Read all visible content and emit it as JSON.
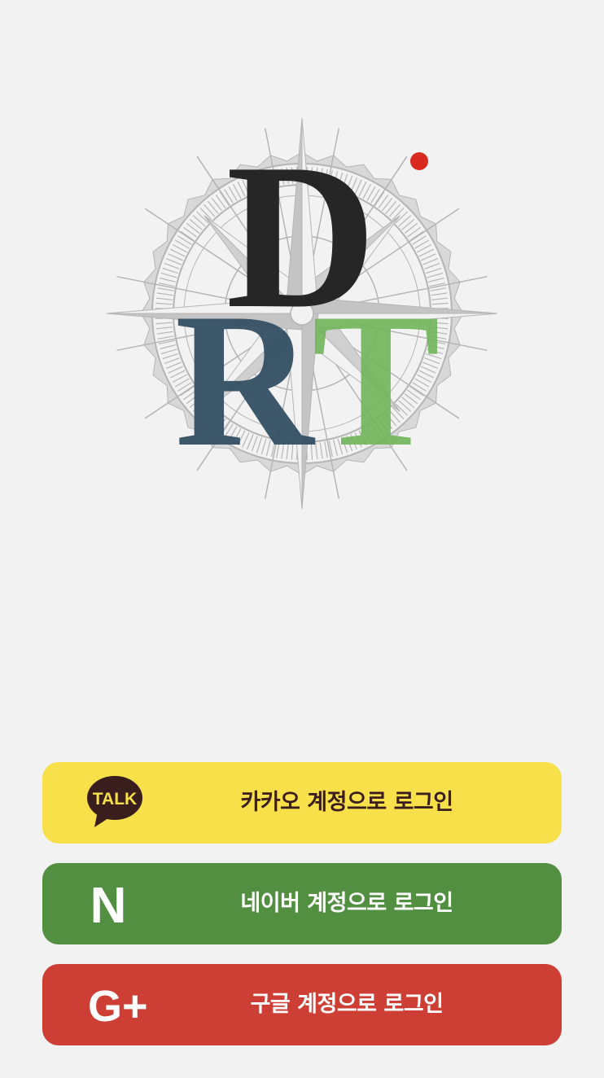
{
  "logo": {
    "letters": [
      "D",
      "R",
      "T"
    ],
    "colors": {
      "d": "#262626",
      "r": "#355064",
      "t": "#72b65a",
      "dot": "#d92a1f",
      "compass": "#b5b5b5"
    }
  },
  "login": {
    "kakao": {
      "label": "카카오 계정으로 로그인",
      "icon": "kakao-talk-icon",
      "icon_text": "TALK",
      "bg": "#f8e04b",
      "text_color": "#3a1d1d"
    },
    "naver": {
      "label": "네이버 계정으로 로그인",
      "icon": "naver-n-icon",
      "icon_text": "N",
      "bg": "#528f40",
      "text_color": "#ffffff"
    },
    "google": {
      "label": "구글 계정으로 로그인",
      "icon": "google-plus-icon",
      "icon_text": "G+",
      "bg": "#cd3f34",
      "text_color": "#ffffff"
    }
  },
  "colors": {
    "background": "#f2f2f2"
  }
}
